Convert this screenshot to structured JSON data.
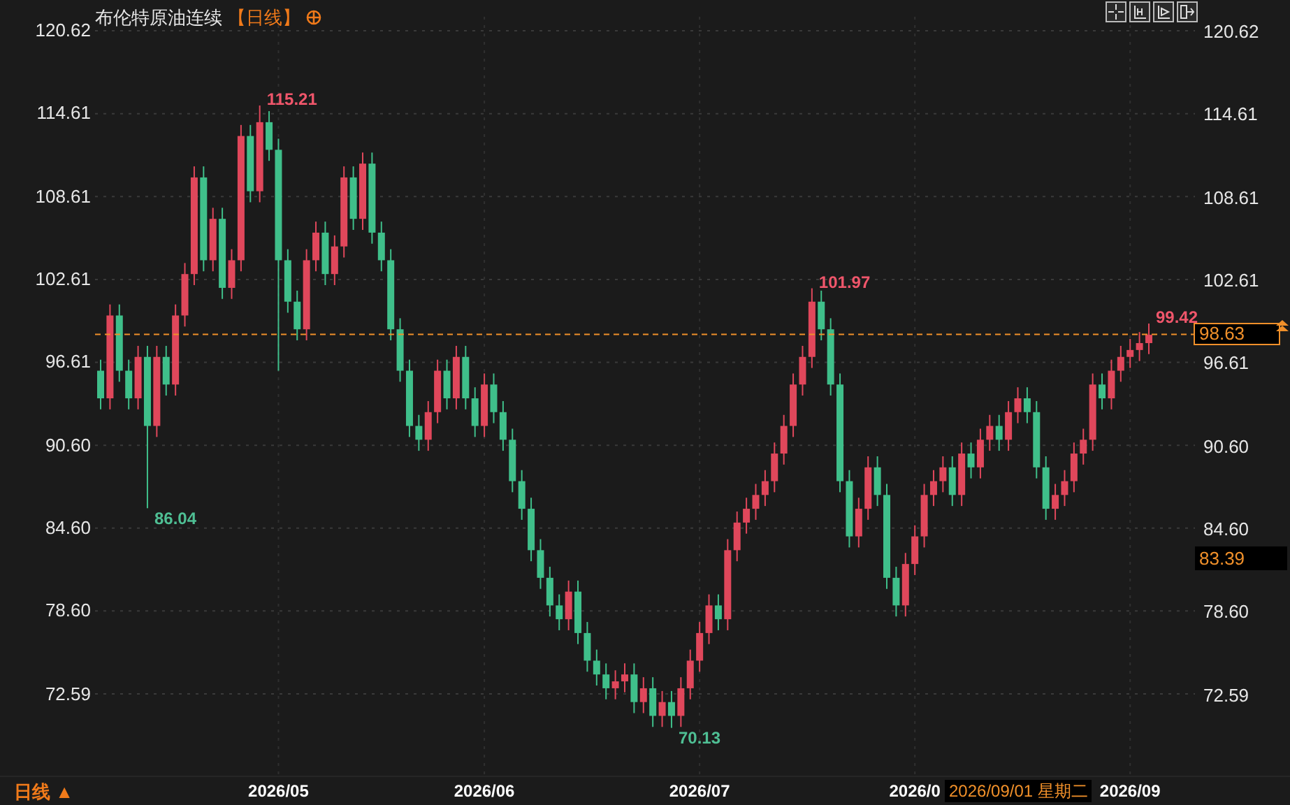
{
  "title": {
    "instrument": "布伦特原油连续",
    "period": "【日线】"
  },
  "chart_data": {
    "type": "candlestick",
    "ylim": [
      66.67,
      122.85
    ],
    "grid": true,
    "ref_lines": [
      {
        "axis": "y",
        "value": 98.63,
        "label": "98.63"
      }
    ],
    "yticks": [
      {
        "value": 120.62,
        "label": "120.62"
      },
      {
        "value": 114.61,
        "label": "114.61"
      },
      {
        "value": 108.61,
        "label": "108.61"
      },
      {
        "value": 102.61,
        "label": "102.61"
      },
      {
        "value": 96.61,
        "label": "96.61"
      },
      {
        "value": 90.6,
        "label": "90.60"
      },
      {
        "value": 84.6,
        "label": "84.60"
      },
      {
        "value": 78.6,
        "label": "78.60"
      },
      {
        "value": 72.59,
        "label": "72.59"
      }
    ],
    "categories": [
      null,
      null,
      null,
      null,
      null,
      null,
      null,
      null,
      null,
      null,
      null,
      null,
      null,
      null,
      null,
      null,
      null,
      null,
      null,
      "2026/05",
      null,
      null,
      null,
      null,
      null,
      null,
      null,
      null,
      null,
      null,
      null,
      null,
      null,
      null,
      null,
      null,
      null,
      null,
      null,
      null,
      null,
      "2026/06",
      null,
      null,
      null,
      null,
      null,
      null,
      null,
      null,
      null,
      null,
      null,
      null,
      null,
      null,
      null,
      null,
      null,
      null,
      null,
      null,
      null,
      null,
      "2026/07",
      null,
      null,
      null,
      null,
      null,
      null,
      null,
      null,
      null,
      null,
      null,
      null,
      null,
      null,
      null,
      null,
      null,
      null,
      null,
      null,
      null,
      null,
      "2026/0",
      null,
      null,
      null,
      null,
      null,
      null,
      null,
      null,
      null,
      null,
      null,
      null,
      null,
      null,
      null,
      null,
      null,
      null,
      null,
      null,
      null,
      null,
      "2026/09",
      null,
      null
    ],
    "ohlc": [
      [
        96,
        96.8,
        93.2,
        94
      ],
      [
        94,
        100.8,
        93.2,
        100
      ],
      [
        100,
        100.8,
        95.2,
        96
      ],
      [
        96,
        96.8,
        93.2,
        94
      ],
      [
        94,
        97.8,
        93.2,
        97
      ],
      [
        97,
        97.8,
        86.04,
        92
      ],
      [
        92,
        97.8,
        91.2,
        97
      ],
      [
        97,
        97.8,
        94.2,
        95
      ],
      [
        95,
        100.8,
        94.2,
        100
      ],
      [
        100,
        103.8,
        99.2,
        103
      ],
      [
        103,
        110.8,
        102.2,
        110
      ],
      [
        110,
        110.8,
        103.2,
        104
      ],
      [
        104,
        107.8,
        103.2,
        107
      ],
      [
        107,
        107.8,
        101.2,
        102
      ],
      [
        102,
        104.8,
        101.2,
        104
      ],
      [
        104,
        113.8,
        103.2,
        113
      ],
      [
        113,
        113.8,
        108.2,
        109
      ],
      [
        109,
        115.21,
        108.2,
        114
      ],
      [
        114,
        114.8,
        111.2,
        112
      ],
      [
        112,
        112.8,
        96,
        104
      ],
      [
        104,
        104.8,
        100.2,
        101
      ],
      [
        101,
        101.8,
        98.2,
        99
      ],
      [
        99,
        104.8,
        98.2,
        104
      ],
      [
        104,
        106.8,
        103.2,
        106
      ],
      [
        106,
        106.8,
        102.2,
        103
      ],
      [
        103,
        105.8,
        102.2,
        105
      ],
      [
        105,
        110.8,
        104.2,
        110
      ],
      [
        110,
        110.8,
        106.2,
        107
      ],
      [
        107,
        111.8,
        106.2,
        111
      ],
      [
        111,
        111.8,
        105.2,
        106
      ],
      [
        106,
        106.8,
        103.2,
        104
      ],
      [
        104,
        104.8,
        98.2,
        99
      ],
      [
        99,
        99.8,
        95.2,
        96
      ],
      [
        96,
        96.8,
        91.2,
        92
      ],
      [
        92,
        92.8,
        90.2,
        91
      ],
      [
        91,
        93.8,
        90.2,
        93
      ],
      [
        93,
        96.8,
        92.2,
        96
      ],
      [
        96,
        96.8,
        93.2,
        94
      ],
      [
        94,
        97.8,
        93.2,
        97
      ],
      [
        97,
        97.8,
        93.2,
        94
      ],
      [
        94,
        94.8,
        91.2,
        92
      ],
      [
        92,
        95.8,
        91.2,
        95
      ],
      [
        95,
        95.8,
        92.2,
        93
      ],
      [
        93,
        93.8,
        90.2,
        91
      ],
      [
        91,
        91.8,
        87.2,
        88
      ],
      [
        88,
        88.8,
        85.2,
        86
      ],
      [
        86,
        86.8,
        82.2,
        83
      ],
      [
        83,
        83.8,
        80.2,
        81
      ],
      [
        81,
        81.8,
        78.2,
        79
      ],
      [
        79,
        79.8,
        77.2,
        78
      ],
      [
        78,
        80.8,
        77.2,
        80
      ],
      [
        80,
        80.8,
        76.2,
        77
      ],
      [
        77,
        77.8,
        74.2,
        75
      ],
      [
        75,
        75.8,
        73.2,
        74
      ],
      [
        74,
        74.8,
        72.2,
        73
      ],
      [
        73,
        74.3,
        72.2,
        73.5
      ],
      [
        73.5,
        74.8,
        72.7,
        74
      ],
      [
        74,
        74.8,
        71.2,
        72
      ],
      [
        72,
        73.8,
        71.2,
        73
      ],
      [
        73,
        73.8,
        70.2,
        71
      ],
      [
        71,
        72.8,
        70.2,
        72
      ],
      [
        72,
        72.8,
        70.13,
        71
      ],
      [
        71,
        73.8,
        70.2,
        73
      ],
      [
        73,
        75.8,
        72.2,
        75
      ],
      [
        75,
        77.8,
        74.2,
        77
      ],
      [
        77,
        79.8,
        76.2,
        79
      ],
      [
        79,
        79.8,
        77.2,
        78
      ],
      [
        78,
        83.8,
        77.2,
        83
      ],
      [
        83,
        85.8,
        82.2,
        85
      ],
      [
        85,
        86.8,
        84.2,
        86
      ],
      [
        86,
        87.8,
        85.2,
        87
      ],
      [
        87,
        88.8,
        86.2,
        88
      ],
      [
        88,
        90.8,
        87.2,
        90
      ],
      [
        90,
        92.8,
        89.2,
        92
      ],
      [
        92,
        95.8,
        91.2,
        95
      ],
      [
        95,
        97.8,
        94.2,
        97
      ],
      [
        97,
        101.97,
        96.2,
        101
      ],
      [
        101,
        101.8,
        98.2,
        99
      ],
      [
        99,
        99.8,
        94.2,
        95
      ],
      [
        95,
        95.8,
        87.2,
        88
      ],
      [
        88,
        88.8,
        83.2,
        84
      ],
      [
        84,
        86.8,
        83.2,
        86
      ],
      [
        86,
        89.8,
        85.2,
        89
      ],
      [
        89,
        89.8,
        86.2,
        87
      ],
      [
        87,
        87.8,
        80.2,
        81
      ],
      [
        81,
        81.8,
        78.2,
        79
      ],
      [
        79,
        82.8,
        78.2,
        82
      ],
      [
        82,
        84.8,
        81.2,
        84
      ],
      [
        84,
        87.8,
        83.2,
        87
      ],
      [
        87,
        88.8,
        86.2,
        88
      ],
      [
        88,
        89.8,
        87.2,
        89
      ],
      [
        89,
        89.8,
        86.2,
        87
      ],
      [
        87,
        90.8,
        86.2,
        90
      ],
      [
        90,
        90.8,
        88.2,
        89
      ],
      [
        89,
        91.8,
        88.2,
        91
      ],
      [
        91,
        92.8,
        90.2,
        92
      ],
      [
        92,
        92.8,
        90.2,
        91
      ],
      [
        91,
        93.8,
        90.2,
        93
      ],
      [
        93,
        94.8,
        92.2,
        94
      ],
      [
        94,
        94.8,
        92.2,
        93
      ],
      [
        93,
        93.8,
        88.2,
        89
      ],
      [
        89,
        89.8,
        85.2,
        86
      ],
      [
        86,
        87.8,
        85.2,
        87
      ],
      [
        87,
        88.8,
        86.2,
        88
      ],
      [
        88,
        90.8,
        87.2,
        90
      ],
      [
        90,
        91.8,
        89.2,
        91
      ],
      [
        91,
        95.8,
        90.2,
        95
      ],
      [
        95,
        95.8,
        93.2,
        94
      ],
      [
        94,
        96.8,
        93.2,
        96
      ],
      [
        96,
        97.8,
        95.2,
        97
      ],
      [
        97,
        98.3,
        96.2,
        97.5
      ],
      [
        97.5,
        98.8,
        96.7,
        98
      ],
      [
        98,
        99.42,
        97.2,
        98.6
      ]
    ],
    "annotations": [
      "115.21",
      "86.04",
      "101.97",
      "70.13",
      "99.42"
    ]
  },
  "right_axis": [
    "120.62",
    "114.61",
    "108.61",
    "102.61",
    "96.61",
    "90.60",
    "84.60",
    "78.60",
    "72.59"
  ],
  "marker_box": {
    "label": "83.39"
  },
  "crosshair_date": "2026/09/01 星期二",
  "period_button": {
    "label": "日线 ▲"
  }
}
